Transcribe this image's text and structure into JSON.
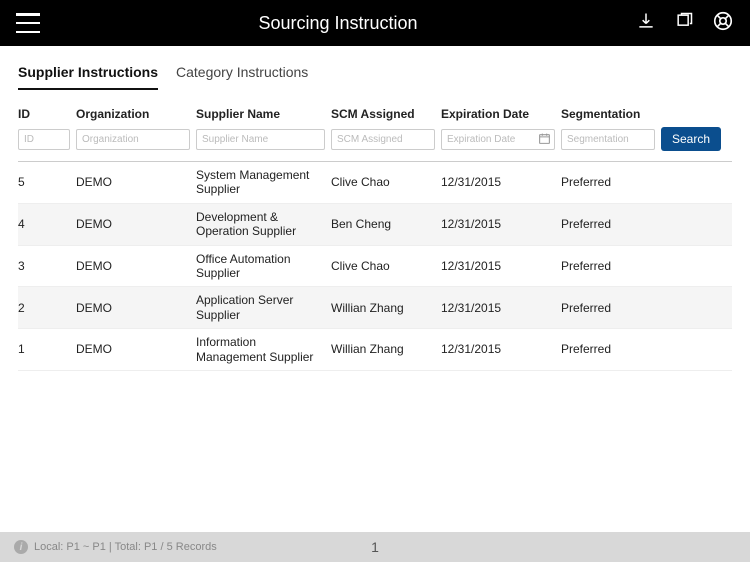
{
  "header": {
    "title": "Sourcing Instruction"
  },
  "tabs": {
    "supplier": "Supplier Instructions",
    "category": "Category Instructions"
  },
  "columns": {
    "id": "ID",
    "organization": "Organization",
    "supplier_name": "Supplier Name",
    "scm_assigned": "SCM Assigned",
    "expiration_date": "Expiration Date",
    "segmentation": "Segmentation"
  },
  "placeholders": {
    "id": "ID",
    "organization": "Organization",
    "supplier_name": "Supplier Name",
    "scm_assigned": "SCM Assigned",
    "expiration_date": "Expiration Date",
    "segmentation": "Segmentation"
  },
  "search_label": "Search",
  "rows": [
    {
      "id": "5",
      "organization": "DEMO",
      "supplier_name": "System Management Supplier",
      "scm_assigned": "Clive Chao",
      "expiration_date": "12/31/2015",
      "segmentation": "Preferred"
    },
    {
      "id": "4",
      "organization": "DEMO",
      "supplier_name": "Development & Operation Supplier",
      "scm_assigned": "Ben Cheng",
      "expiration_date": "12/31/2015",
      "segmentation": "Preferred"
    },
    {
      "id": "3",
      "organization": "DEMO",
      "supplier_name": "Office Automation Supplier",
      "scm_assigned": "Clive Chao",
      "expiration_date": "12/31/2015",
      "segmentation": "Preferred"
    },
    {
      "id": "2",
      "organization": "DEMO",
      "supplier_name": "Application Server Supplier",
      "scm_assigned": "Willian Zhang",
      "expiration_date": "12/31/2015",
      "segmentation": "Preferred"
    },
    {
      "id": "1",
      "organization": "DEMO",
      "supplier_name": "Information Management Supplier",
      "scm_assigned": "Willian Zhang",
      "expiration_date": "12/31/2015",
      "segmentation": "Preferred"
    }
  ],
  "footer": {
    "status": "Local: P1 ~ P1 | Total: P1 / 5 Records",
    "page": "1"
  }
}
